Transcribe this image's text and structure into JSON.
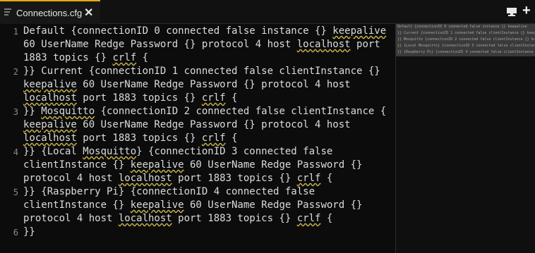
{
  "tab": {
    "title": "Connections.cfg",
    "close_label": "✕"
  },
  "toolbar": {
    "plus_label": "+",
    "download_icon": "download-icon"
  },
  "line_numbers": [
    "1",
    "2",
    "3",
    "4",
    "5",
    "6"
  ],
  "code_lines": [
    "Default {connectionID 0 connected false instance {} keepalive",
    "60 UserName Redge Password {} protocol 4 host localhost port",
    "1883 topics {} crlf {",
    "}} Current {connectionID 1 connected false clientInstance {}",
    "keepalive 60 UserName Redge Password {} protocol 4 host",
    "localhost port 1883 topics {} crlf {",
    "}} Mosquitto {connectionID 2 connected false clientInstance {}",
    "keepalive 60 UserName Redge Password {} protocol 4 host",
    "localhost port 1883 topics {} crlf {",
    "}} {Local Mosquitto} {connectionID 3 connected false",
    "clientInstance {} keepalive 60 UserName Redge Password {}",
    "protocol 4 host localhost port 1883 topics {} crlf {",
    "}} {Raspberry Pi} {connectionID 4 connected false",
    "clientInstance {} keepalive 60 UserName Redge Password {}",
    "protocol 4 host localhost port 1883 topics {} crlf {",
    "}}"
  ],
  "minimap_lines": [
    "Default {connectionID 0 connected false instance {} keepalive",
    "}} Current {connectionID 1 connected false clientInstance {} keepalive",
    "}} Mosquitto {connectionID 2 connected false clientInstance {} keepalive",
    "}} {Local Mosquitto} {connectionID 3 connected false clientInstance",
    "}} {Raspberry Pi} {connectionID 4 connected false clientInstance"
  ],
  "colors": {
    "accent": "#e6a817",
    "background": "#0c0c0c",
    "squiggle": "#c9b54a"
  }
}
